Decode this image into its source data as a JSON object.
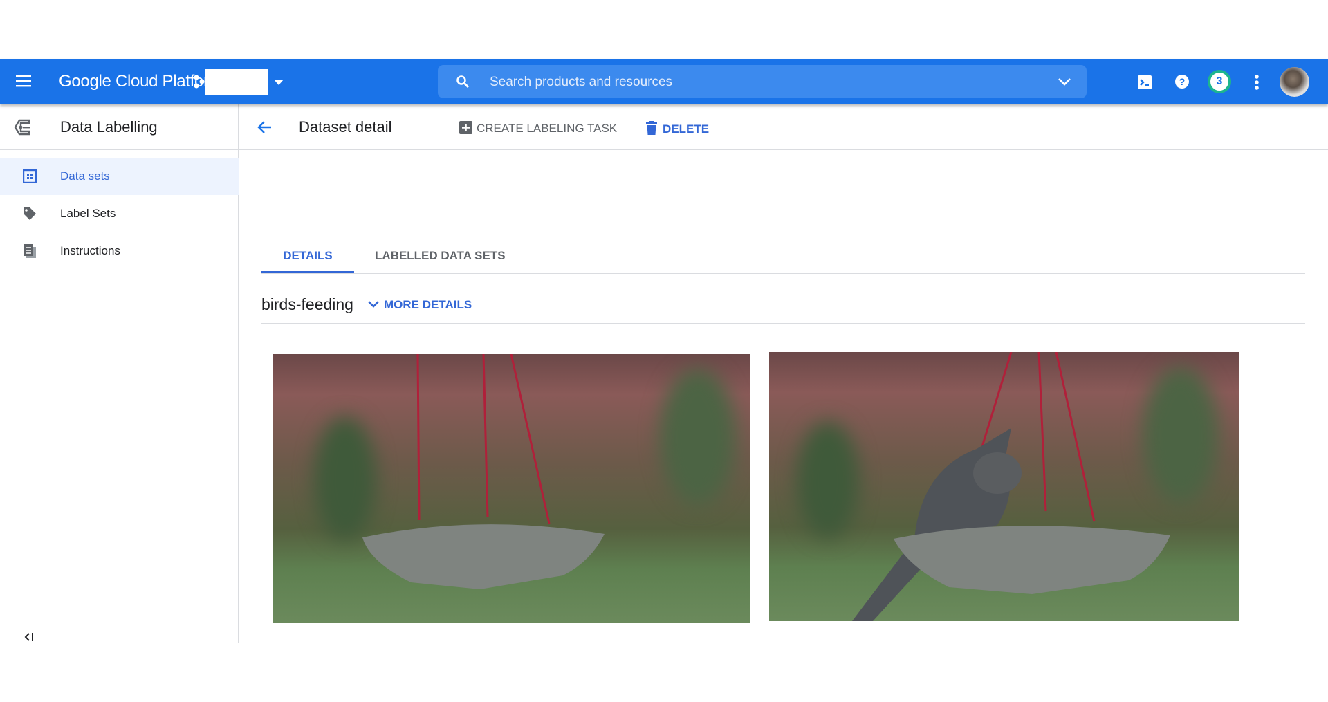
{
  "header": {
    "app_title": "Google Cloud Platform",
    "search_placeholder": "Search products and resources",
    "notification_count": "3"
  },
  "product": {
    "title": "Data Labelling"
  },
  "sidebar": {
    "items": [
      {
        "label": "Data sets",
        "active": true
      },
      {
        "label": "Label Sets"
      },
      {
        "label": "Instructions"
      }
    ]
  },
  "page": {
    "title": "Dataset detail",
    "create_task_label": "CREATE LABELING TASK",
    "delete_label": "DELETE"
  },
  "tabs": [
    {
      "label": "DETAILS",
      "active": true
    },
    {
      "label": "LABELLED DATA SETS"
    }
  ],
  "dataset": {
    "name": "birds-feeding",
    "more_details_label": "MORE DETAILS"
  },
  "colors": {
    "brand": "#1a73e8",
    "accent": "#3367d6",
    "badge_ring": "#1db58f"
  }
}
